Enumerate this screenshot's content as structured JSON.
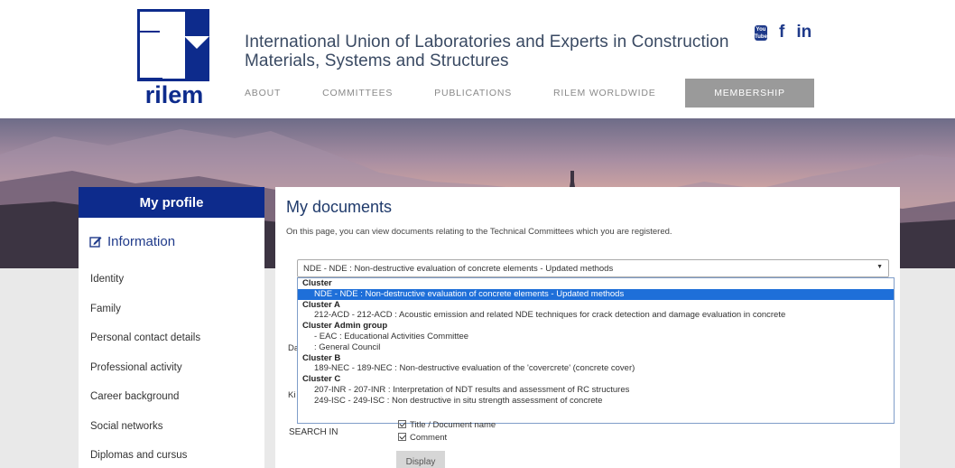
{
  "header": {
    "logo_text": "rilem",
    "org_title_line1": "International Union of Laboratories and Experts in Construction",
    "org_title_line2": "Materials, Systems and Structures",
    "social": {
      "youtube": "You Tube",
      "facebook": "f",
      "linkedin": "in"
    },
    "nav": [
      "ABOUT",
      "COMMITTEES",
      "PUBLICATIONS",
      "RILEM WORLDWIDE"
    ],
    "membership": "MEMBERSHIP"
  },
  "sidebar": {
    "title": "My profile",
    "section": "Information",
    "items": [
      "Identity",
      "Family",
      "Personal contact details",
      "Professional activity",
      "Career background",
      "Social networks",
      "Diplomas and cursus"
    ]
  },
  "main": {
    "title": "My documents",
    "description": "On this page, you can view documents relating to the Technical Committees which you are registered.",
    "select_value": "NDE - NDE : Non-destructive evaluation of concrete elements - Updated methods",
    "dropdown": [
      {
        "group": "Cluster",
        "options": [
          "NDE - NDE : Non-destructive evaluation of concrete elements - Updated methods"
        ]
      },
      {
        "group": "Cluster A",
        "options": [
          "212-ACD - 212-ACD : Acoustic emission and related NDE techniques for crack detection and damage evaluation in concrete"
        ]
      },
      {
        "group": "Cluster Admin group",
        "options": [
          "- EAC : Educational Activities Committee",
          ": General Council"
        ]
      },
      {
        "group": "Cluster B",
        "options": [
          "189-NEC - 189-NEC : Non-destructive evaluation of the 'covercrete' (concrete cover)"
        ]
      },
      {
        "group": "Cluster C",
        "options": [
          "207-INR - 207-INR : Interpretation of NDT results and assessment of RC structures",
          "249-ISC - 249-ISC : Non destructive in situ strength assessment of concrete"
        ]
      }
    ],
    "hidden_label_d": "Da",
    "hidden_label_k": "Ki",
    "search_in": "SEARCH IN",
    "check_title": "Title / Document name",
    "check_comment": "Comment",
    "display_button": "Display"
  },
  "colors": {
    "brand": "#0d2b8c",
    "selected_option": "#1e6fd9",
    "membership_bg": "#9a9a9a"
  }
}
